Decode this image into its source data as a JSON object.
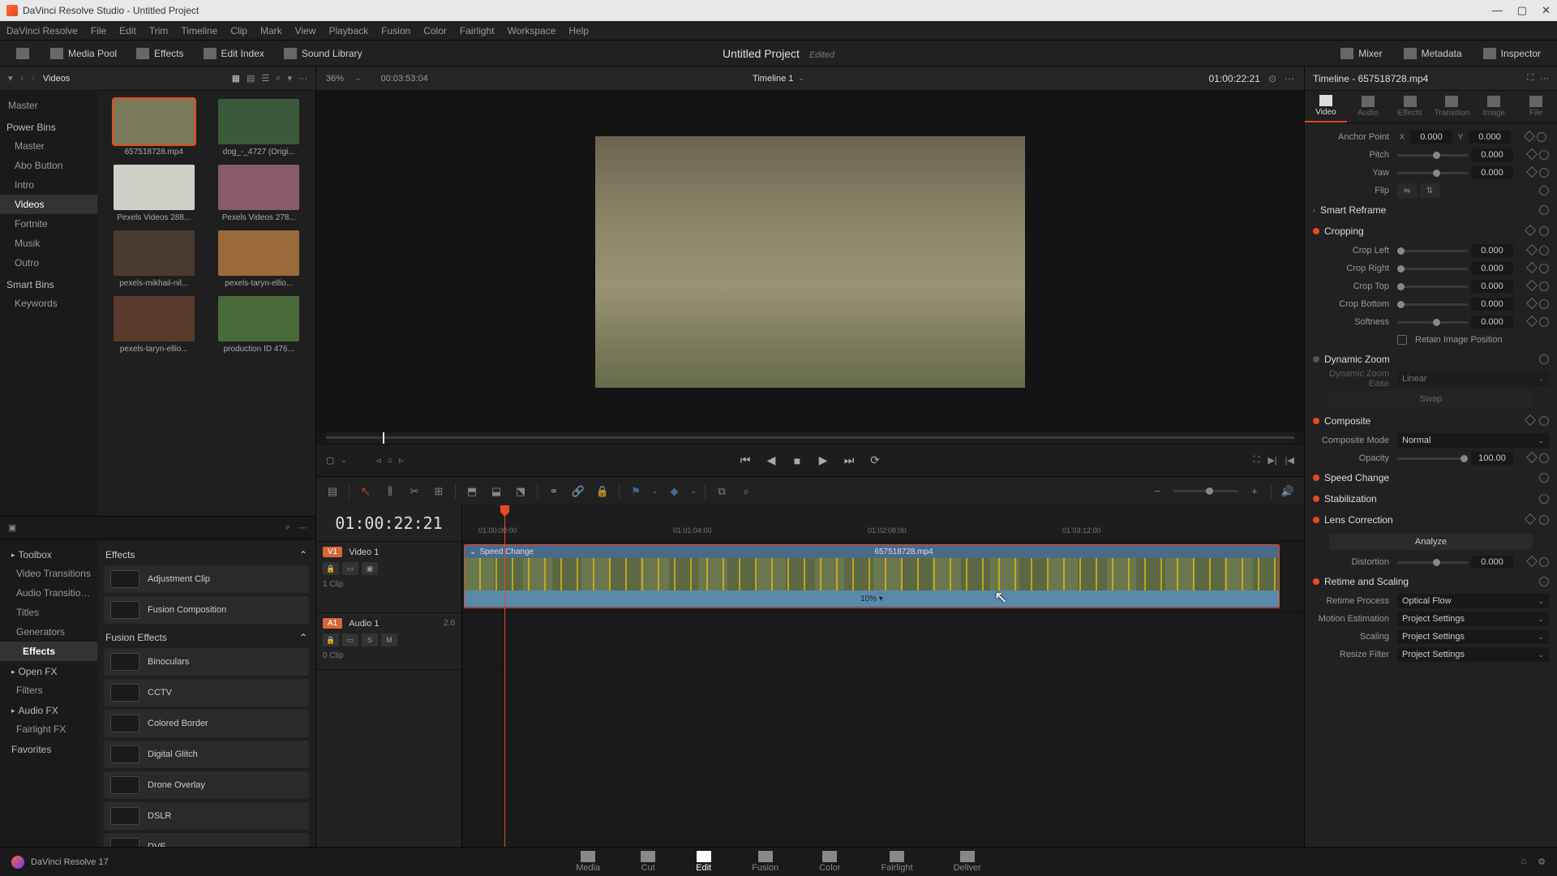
{
  "titlebar": {
    "app": "DaVinci Resolve Studio",
    "project": "Untitled Project"
  },
  "menubar": [
    "DaVinci Resolve",
    "File",
    "Edit",
    "Trim",
    "Timeline",
    "Clip",
    "Mark",
    "View",
    "Playback",
    "Fusion",
    "Color",
    "Fairlight",
    "Workspace",
    "Help"
  ],
  "toolbar": {
    "left": [
      {
        "icon": "media-pool",
        "label": "Media Pool"
      },
      {
        "icon": "effects",
        "label": "Effects"
      },
      {
        "icon": "edit-index",
        "label": "Edit Index"
      },
      {
        "icon": "sound-lib",
        "label": "Sound Library"
      }
    ],
    "project_title": "Untitled Project",
    "edited": "Edited",
    "right": [
      {
        "icon": "mixer",
        "label": "Mixer"
      },
      {
        "icon": "metadata",
        "label": "Metadata"
      },
      {
        "icon": "inspector",
        "label": "Inspector"
      }
    ]
  },
  "media": {
    "header_title": "Videos",
    "folders": {
      "master": "Master",
      "power_bins": "Power Bins",
      "items": [
        "Master",
        "Abo Button",
        "Intro",
        "Videos",
        "Fortnite",
        "Musik",
        "Outro"
      ],
      "selected": "Videos",
      "smart_bins": "Smart Bins",
      "keywords": "Keywords"
    },
    "clips": [
      {
        "name": "657518728.mp4",
        "selected": true,
        "bg": "#7a7a5a"
      },
      {
        "name": "dog_-_4727 (Origi...",
        "bg": "#3a5a3a"
      },
      {
        "name": "Pexels Videos 288...",
        "bg": "#d0d0c8"
      },
      {
        "name": "Pexels Videos 278...",
        "bg": "#8a5a6a"
      },
      {
        "name": "pexels-mikhail-nil...",
        "bg": "#4a3a30"
      },
      {
        "name": "pexels-taryn-ellio...",
        "bg": "#9a6a3a"
      },
      {
        "name": "pexels-taryn-ellio...",
        "bg": "#5a3a2a"
      },
      {
        "name": "production ID 476...",
        "bg": "#4a6a3a"
      }
    ]
  },
  "effects": {
    "tree": [
      {
        "label": "Toolbox",
        "head": true
      },
      {
        "label": "Video Transitions"
      },
      {
        "label": "Audio Transitions"
      },
      {
        "label": "Titles"
      },
      {
        "label": "Generators"
      },
      {
        "label": "Effects",
        "bold": true,
        "selected": true
      },
      {
        "label": "Open FX",
        "head": true
      },
      {
        "label": "Filters"
      },
      {
        "label": "Audio FX",
        "head": true
      },
      {
        "label": "Fairlight FX"
      }
    ],
    "favorites": "Favorites",
    "list_head1": "Effects",
    "items1": [
      "Adjustment Clip",
      "Fusion Composition"
    ],
    "list_head2": "Fusion Effects",
    "items2": [
      "Binoculars",
      "CCTV",
      "Colored Border",
      "Digital Glitch",
      "Drone Overlay",
      "DSLR",
      "DVE"
    ]
  },
  "viewer": {
    "zoom": "36%",
    "tc_left": "00:03:53:04",
    "timeline_name": "Timeline 1",
    "tc_right": "01:00:22:21"
  },
  "timeline": {
    "tc": "01:00:22:21",
    "ruler": [
      "01:00:00:00",
      "01:01:04:00",
      "01:02:08:00",
      "01:03:12:00"
    ],
    "tracks": [
      {
        "badge": "V1",
        "name": "Video 1",
        "clips": "1 Clip",
        "type": "video"
      },
      {
        "badge": "A1",
        "name": "Audio 1",
        "clips": "0 Clip",
        "type": "audio",
        "meter": "2.0"
      }
    ],
    "clip": {
      "speed_label": "Speed Change",
      "name": "657518728.mp4",
      "speed": "10%"
    }
  },
  "inspector": {
    "title": "Timeline - 657518728.mp4",
    "tabs": [
      "Video",
      "Audio",
      "Effects",
      "Transition",
      "Image",
      "File"
    ],
    "active_tab": "Video",
    "anchor": {
      "label": "Anchor Point",
      "x_label": "X",
      "x": "0.000",
      "y_label": "Y",
      "y": "0.000"
    },
    "transform": [
      {
        "label": "Pitch",
        "value": "0.000",
        "pos": 50
      },
      {
        "label": "Yaw",
        "value": "0.000",
        "pos": 50
      }
    ],
    "flip": "Flip",
    "smart_reframe": "Smart Reframe",
    "cropping": {
      "title": "Cropping",
      "props": [
        {
          "label": "Crop Left",
          "value": "0.000",
          "pos": 0
        },
        {
          "label": "Crop Right",
          "value": "0.000",
          "pos": 0
        },
        {
          "label": "Crop Top",
          "value": "0.000",
          "pos": 0
        },
        {
          "label": "Crop Bottom",
          "value": "0.000",
          "pos": 0
        },
        {
          "label": "Softness",
          "value": "0.000",
          "pos": 50
        }
      ],
      "retain": "Retain Image Position"
    },
    "dynamic_zoom": {
      "title": "Dynamic Zoom",
      "ease_label": "Dynamic Zoom Ease",
      "ease": "Linear",
      "swap": "Swap"
    },
    "composite": {
      "title": "Composite",
      "mode_label": "Composite Mode",
      "mode": "Normal",
      "opacity_label": "Opacity",
      "opacity": "100.00"
    },
    "speed_change": "Speed Change",
    "stabilization": "Stabilization",
    "lens": {
      "title": "Lens Correction",
      "analyze": "Analyze",
      "distortion_label": "Distortion",
      "distortion": "0.000"
    },
    "retime": {
      "title": "Retime and Scaling",
      "process_label": "Retime Process",
      "process": "Optical Flow",
      "motion_label": "Motion Estimation",
      "motion": "Project Settings",
      "scaling_label": "Scaling",
      "scaling": "Project Settings",
      "resize_label": "Resize Filter",
      "resize": "Project Settings"
    }
  },
  "bottom_nav": {
    "items": [
      "Media",
      "Cut",
      "Edit",
      "Fusion",
      "Color",
      "Fairlight",
      "Deliver"
    ],
    "active": "Edit",
    "version": "DaVinci Resolve 17"
  }
}
